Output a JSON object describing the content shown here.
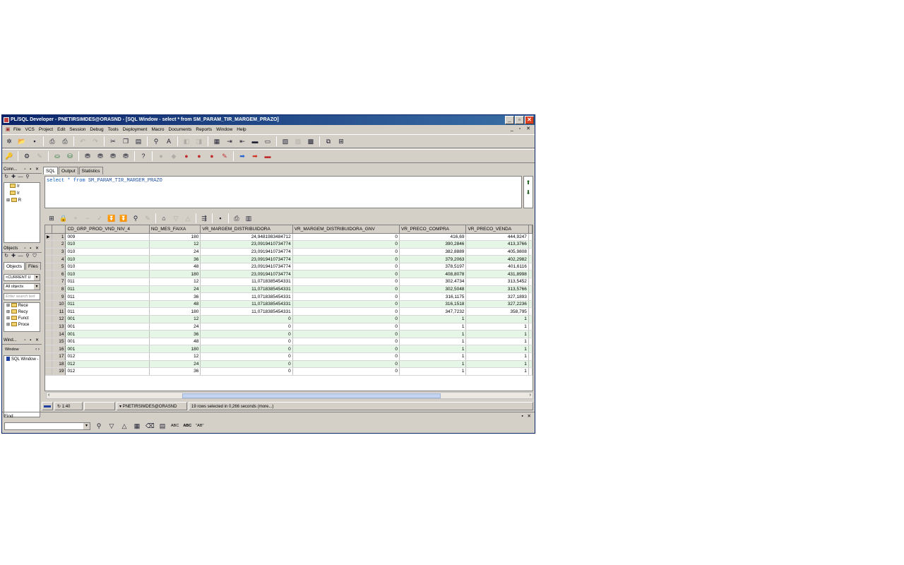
{
  "window": {
    "title": "PL/SQL Developer - PNETIRSIMDES@ORASND - [SQL Window - select * from SM_PARAM_TIR_MARGEM_PRAZO]"
  },
  "menu": [
    "File",
    "VCS",
    "Project",
    "Edit",
    "Session",
    "Debug",
    "Tools",
    "Deployment",
    "Macro",
    "Documents",
    "Reports",
    "Window",
    "Help"
  ],
  "panels": {
    "connections": {
      "title": "Conn...",
      "items": [
        "Ir",
        "Ir",
        "R"
      ]
    },
    "objects": {
      "title": "Objects",
      "tabs": [
        "Objects",
        "Files"
      ],
      "user_combo": "<CURRENT U",
      "filter_combo": "All objects",
      "search_placeholder": "Enter search text",
      "items": [
        "Rece",
        "Recy",
        "Funct",
        "Proce"
      ]
    },
    "windows": {
      "title": "Wind...",
      "combo": "Window",
      "items": [
        "SQL Window -"
      ]
    }
  },
  "editor": {
    "tabs": [
      "SQL",
      "Output",
      "Statistics"
    ],
    "sql": {
      "select": "select",
      "star": "*",
      "from": "from",
      "table": "SM_PARAM_TIR_MARGEM_PRAZO"
    }
  },
  "grid": {
    "columns": [
      "CD_GRP_PROD_VND_NIV_4",
      "NO_MES_FAIXA",
      "VR_MARGEM_DISTRIBUIDORA",
      "VR_MARGEM_DISTRIBUIDORA_GNV",
      "VR_PRECO_COMPRA",
      "VR_PRECO_VENDA"
    ],
    "rows": [
      [
        "009",
        "180",
        "24,9481983484712",
        "0",
        "416,69",
        "444,9247"
      ],
      [
        "010",
        "12",
        "23,0919410734774",
        "0",
        "390,2846",
        "413,3766"
      ],
      [
        "010",
        "24",
        "23,0919410734774",
        "0",
        "382,8889",
        "405,9808"
      ],
      [
        "010",
        "36",
        "23,0919410734774",
        "0",
        "379,2063",
        "402,2982"
      ],
      [
        "010",
        "48",
        "23,0919410734774",
        "0",
        "378,5197",
        "401,6116"
      ],
      [
        "010",
        "180",
        "23,0919410734774",
        "0",
        "408,8078",
        "431,8998"
      ],
      [
        "011",
        "12",
        "11,0718385454331",
        "0",
        "302,4734",
        "313,5452"
      ],
      [
        "011",
        "24",
        "11,0718385454331",
        "0",
        "302,5048",
        "313,5766"
      ],
      [
        "011",
        "36",
        "11,0718385454331",
        "0",
        "316,1175",
        "327,1893"
      ],
      [
        "011",
        "48",
        "11,0718385454331",
        "0",
        "316,1518",
        "327,2236"
      ],
      [
        "011",
        "180",
        "11,0718385454331",
        "0",
        "347,7232",
        "358,795"
      ],
      [
        "001",
        "12",
        "0",
        "0",
        "1",
        "1"
      ],
      [
        "001",
        "24",
        "0",
        "0",
        "1",
        "1"
      ],
      [
        "001",
        "36",
        "0",
        "0",
        "1",
        "1"
      ],
      [
        "001",
        "48",
        "0",
        "0",
        "1",
        "1"
      ],
      [
        "001",
        "180",
        "0",
        "0",
        "1",
        "1"
      ],
      [
        "012",
        "12",
        "0",
        "0",
        "1",
        "1"
      ],
      [
        "012",
        "24",
        "0",
        "0",
        "1",
        "1"
      ],
      [
        "012",
        "36",
        "0",
        "0",
        "1",
        "1"
      ]
    ]
  },
  "status": {
    "position": "1:40",
    "connection": "PNETIRSIMDES@ORASND",
    "message": "19 rows selected in 0,266 seconds (more...)"
  },
  "find": {
    "label": "Find",
    "abc": "ABC",
    "abc2": "ABC",
    "ab": "\"AB\""
  }
}
